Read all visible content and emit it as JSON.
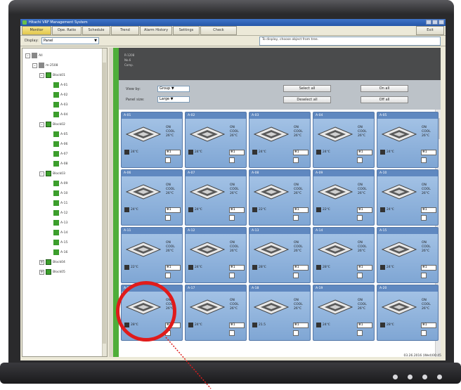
{
  "window": {
    "title": "Hitachi VRF Management System"
  },
  "menu": [
    {
      "label": "Monitor",
      "active": true
    },
    {
      "label": "Ope. Ratio",
      "active": false
    },
    {
      "label": "Schedule",
      "active": false
    },
    {
      "label": "Trend",
      "active": false
    },
    {
      "label": "Alarm History",
      "active": false
    },
    {
      "label": "Settings",
      "active": false
    },
    {
      "label": "Check",
      "active": false
    },
    {
      "label": "Exit",
      "active": false
    }
  ],
  "display": {
    "label": "Display:",
    "value": "Panel"
  },
  "message": "To display, choose object from tree.",
  "tree": {
    "root": "All",
    "site": "m-2508",
    "groups": [
      {
        "label": "Block01",
        "units": [
          "A-01",
          "A-02",
          "A-03",
          "A-04"
        ]
      },
      {
        "label": "Block02",
        "units": [
          "A-05",
          "A-06",
          "A-07",
          "A-08"
        ]
      },
      {
        "label": "Block03",
        "units": [
          "A-09",
          "A-10",
          "A-11",
          "A-12",
          "A-13",
          "A-14",
          "A-15",
          "A-16"
        ]
      },
      {
        "label": "Block04",
        "units": []
      },
      {
        "label": "Block05",
        "units": []
      }
    ]
  },
  "info": {
    "line1": "R-1208",
    "line2": "No.6",
    "line3": "Comp."
  },
  "controls": {
    "view_by_label": "View by:",
    "view_by_value": "Group",
    "panel_size_label": "Panel size:",
    "panel_size_value": "Large",
    "select_all": "Select all",
    "deselect_all": "Deselect all",
    "on_all": "On all",
    "off_all": "Off all"
  },
  "tiles": [
    {
      "id": "A-01",
      "status": "ON",
      "mode": "COOL",
      "set": "26°C",
      "room": "24℃",
      "fan": "1"
    },
    {
      "id": "A-02",
      "status": "ON",
      "mode": "COOL",
      "set": "26°C",
      "room": "24℃",
      "fan": "1"
    },
    {
      "id": "A-03",
      "status": "ON",
      "mode": "COOL",
      "set": "26°C",
      "room": "24℃",
      "fan": "1"
    },
    {
      "id": "A-04",
      "status": "ON",
      "mode": "COOL",
      "set": "26°C",
      "room": "24℃",
      "fan": "1"
    },
    {
      "id": "A-05",
      "status": "ON",
      "mode": "COOL",
      "set": "26°C",
      "room": "24℃",
      "fan": "1"
    },
    {
      "id": "A-06",
      "status": "ON",
      "mode": "COOL",
      "set": "26°C",
      "room": "24℃",
      "fan": "1"
    },
    {
      "id": "A-07",
      "status": "ON",
      "mode": "COOL",
      "set": "26°C",
      "room": "24℃",
      "fan": "1"
    },
    {
      "id": "A-08",
      "status": "ON",
      "mode": "COOL",
      "set": "26°C",
      "room": "22℃",
      "fan": "1"
    },
    {
      "id": "A-09",
      "status": "ON",
      "mode": "COOL",
      "set": "26°C",
      "room": "22℃",
      "fan": "1"
    },
    {
      "id": "A-10",
      "status": "ON",
      "mode": "COOL",
      "set": "26°C",
      "room": "24℃",
      "fan": "1"
    },
    {
      "id": "A-11",
      "status": "ON",
      "mode": "COOL",
      "set": "26°C",
      "room": "22℃",
      "fan": "1"
    },
    {
      "id": "A-12",
      "status": "ON",
      "mode": "COOL",
      "set": "26°C",
      "room": "24℃",
      "fan": "1"
    },
    {
      "id": "A-13",
      "status": "ON",
      "mode": "COOL",
      "set": "26°C",
      "room": "28℃",
      "fan": "1"
    },
    {
      "id": "A-14",
      "status": "ON",
      "mode": "COOL",
      "set": "26°C",
      "room": "28℃",
      "fan": "1"
    },
    {
      "id": "A-15",
      "status": "ON",
      "mode": "COOL",
      "set": "26°C",
      "room": "24℃",
      "fan": "1"
    },
    {
      "id": "A-16",
      "status": "ON",
      "mode": "COOL",
      "set": "26°C",
      "room": "28℃",
      "fan": "1"
    },
    {
      "id": "A-17",
      "status": "ON",
      "mode": "COOL",
      "set": "26°C",
      "room": "24℃",
      "fan": "1"
    },
    {
      "id": "A-18",
      "status": "ON",
      "mode": "COOL",
      "set": "26°C",
      "room": "21.5",
      "fan": "1"
    },
    {
      "id": "A-19",
      "status": "ON",
      "mode": "COOL",
      "set": "26°C",
      "room": "24℃",
      "fan": "1"
    },
    {
      "id": "A-20",
      "status": "ON",
      "mode": "COOL",
      "set": "26°C",
      "room": "28℃",
      "fan": "1"
    }
  ],
  "statusbar": {
    "timestamp": "03.26.2016 (Wed)00:45"
  },
  "colors": {
    "accent": "#e01b1b",
    "tile": "#8fb3dd",
    "green": "#4fae3a"
  }
}
